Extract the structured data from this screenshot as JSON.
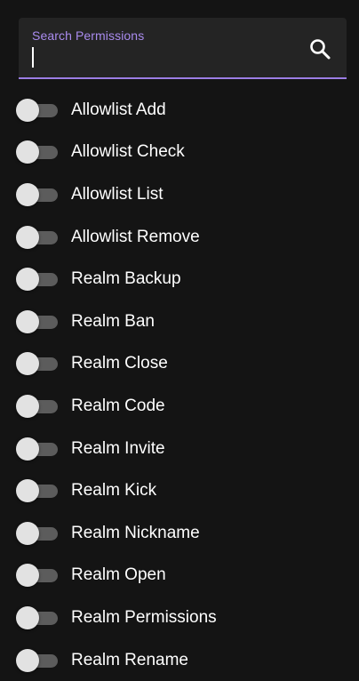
{
  "search": {
    "label": "Search Permissions",
    "value": "",
    "placeholder": "",
    "icon": "search-icon"
  },
  "permissions": [
    {
      "label": "Allowlist Add",
      "enabled": false
    },
    {
      "label": "Allowlist Check",
      "enabled": false
    },
    {
      "label": "Allowlist List",
      "enabled": false
    },
    {
      "label": "Allowlist Remove",
      "enabled": false
    },
    {
      "label": "Realm Backup",
      "enabled": false
    },
    {
      "label": "Realm Ban",
      "enabled": false
    },
    {
      "label": "Realm Close",
      "enabled": false
    },
    {
      "label": "Realm Code",
      "enabled": false
    },
    {
      "label": "Realm Invite",
      "enabled": false
    },
    {
      "label": "Realm Kick",
      "enabled": false
    },
    {
      "label": "Realm Nickname",
      "enabled": false
    },
    {
      "label": "Realm Open",
      "enabled": false
    },
    {
      "label": "Realm Permissions",
      "enabled": false
    },
    {
      "label": "Realm Rename",
      "enabled": false
    }
  ],
  "colors": {
    "background": "#141414",
    "field_background": "#242424",
    "accent": "#9b7de4",
    "toggle_track": "#5c5c5c",
    "toggle_thumb": "#e2e2e2"
  }
}
